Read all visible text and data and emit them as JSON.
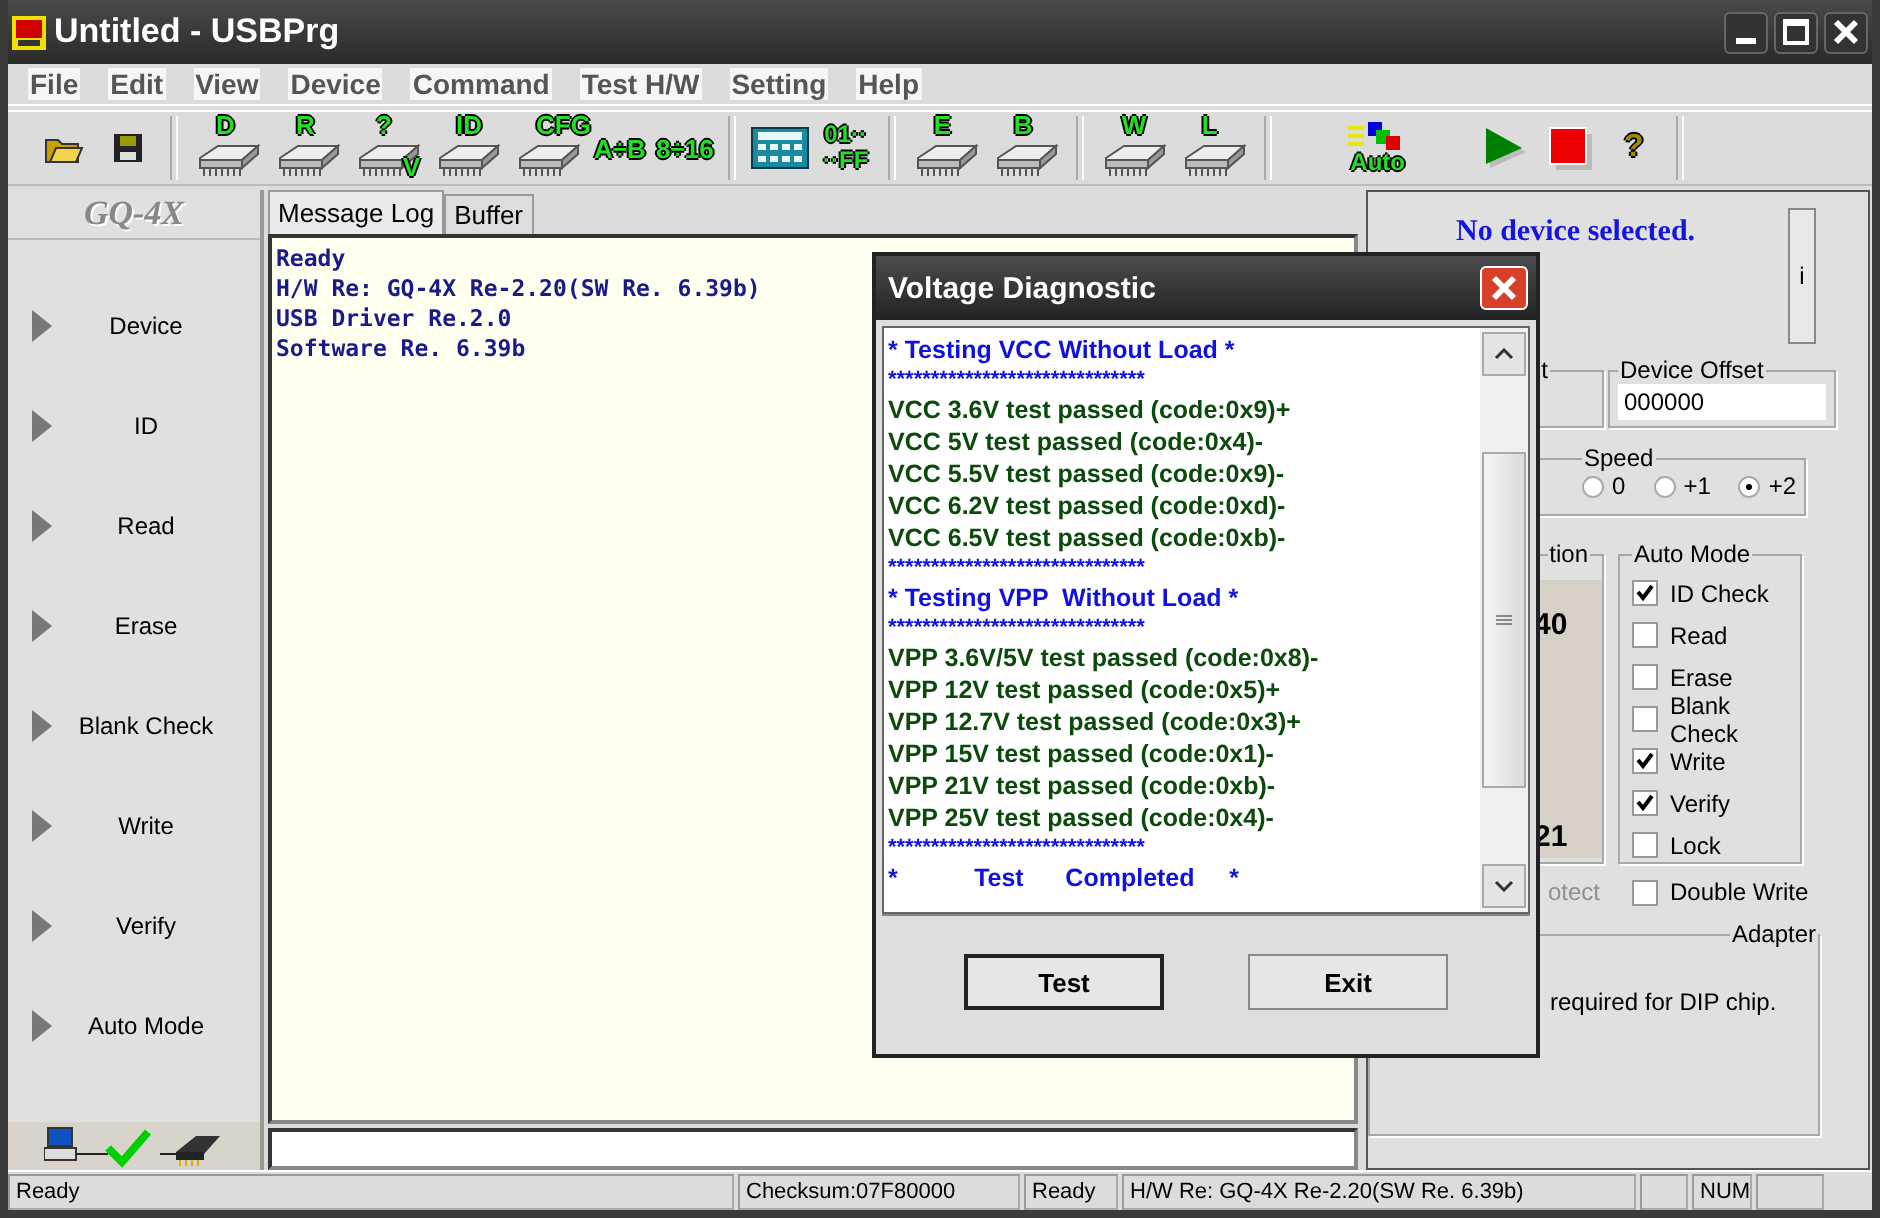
{
  "window": {
    "title": "Untitled - USBPrg"
  },
  "menu": [
    "File",
    "Edit",
    "View",
    "Device",
    "Command",
    "Test H/W",
    "Setting",
    "Help"
  ],
  "toolbar": [
    {
      "kind": "open"
    },
    {
      "kind": "save"
    },
    {
      "kind": "separator"
    },
    {
      "kind": "chip",
      "label": "D"
    },
    {
      "kind": "chip",
      "label": "R"
    },
    {
      "kind": "chip",
      "label": "?",
      "sub": "V"
    },
    {
      "kind": "chip",
      "label": "ID"
    },
    {
      "kind": "chip",
      "label": "CFG"
    },
    {
      "kind": "text",
      "label": "A÷B"
    },
    {
      "kind": "text",
      "label": "8÷16"
    },
    {
      "kind": "separator"
    },
    {
      "kind": "calculator"
    },
    {
      "kind": "hex",
      "label": "01··",
      "sub": "··FF"
    },
    {
      "kind": "separator"
    },
    {
      "kind": "chip",
      "label": "E"
    },
    {
      "kind": "chip",
      "label": "B"
    },
    {
      "kind": "separator"
    },
    {
      "kind": "chip",
      "label": "W"
    },
    {
      "kind": "chip",
      "label": "L"
    },
    {
      "kind": "separator"
    },
    {
      "kind": "auto",
      "label": "Auto"
    },
    {
      "kind": "play"
    },
    {
      "kind": "stop"
    },
    {
      "kind": "help",
      "label": "?"
    },
    {
      "kind": "separator"
    }
  ],
  "sidebar": {
    "logo": "GQ-4X",
    "items": [
      "Device",
      "ID",
      "Read",
      "Erase",
      "Blank Check",
      "Write",
      "Verify",
      "Auto Mode"
    ]
  },
  "tabs": [
    {
      "label": "Message Log",
      "selected": true
    },
    {
      "label": "Buffer",
      "selected": false
    }
  ],
  "message_log": [
    "Ready",
    "H/W Re: GQ-4X Re-2.20(SW Re. 6.39b)",
    "USB Driver Re.2.0",
    "Software Re. 6.39b"
  ],
  "right_panel": {
    "device_status": "No device selected.",
    "info_button": "i",
    "left_group": {
      "label": "t"
    },
    "device_offset": {
      "label": "Device Offset",
      "value": "000000"
    },
    "speed": {
      "label": "Speed",
      "options": [
        {
          "label": "0",
          "selected": false
        },
        {
          "label": "+1",
          "selected": false
        },
        {
          "label": "+2",
          "selected": true
        }
      ]
    },
    "chip_group": {
      "label": "tion",
      "pins": [
        "40",
        "21"
      ]
    },
    "auto_mode": {
      "label": "Auto Mode",
      "options": [
        {
          "label": "ID Check",
          "checked": true
        },
        {
          "label": "Read",
          "checked": false
        },
        {
          "label": "Erase",
          "checked": false
        },
        {
          "label": "Blank Check",
          "checked": false
        },
        {
          "label": "Write",
          "checked": true
        },
        {
          "label": "Verify",
          "checked": true
        },
        {
          "label": "Lock",
          "checked": false
        }
      ]
    },
    "write_protect": {
      "label": "otect",
      "disabled": true
    },
    "double_write": {
      "label": "Double Write",
      "checked": false
    },
    "adapter": {
      "label": "Adapter",
      "note": "required for DIP chip."
    }
  },
  "dialog": {
    "title": "Voltage Diagnostic",
    "lines": [
      {
        "kind": "header",
        "text": "* Testing VCC Without Load *"
      },
      {
        "kind": "stars",
        "text": "******************************"
      },
      {
        "kind": "result",
        "text": "VCC 3.6V test passed (code:0x9)+"
      },
      {
        "kind": "result",
        "text": "VCC 5V test passed (code:0x4)-"
      },
      {
        "kind": "result",
        "text": "VCC 5.5V test passed (code:0x9)-"
      },
      {
        "kind": "result",
        "text": "VCC 6.2V test passed (code:0xd)-"
      },
      {
        "kind": "result",
        "text": "VCC 6.5V test passed (code:0xb)-"
      },
      {
        "kind": "stars",
        "text": "******************************"
      },
      {
        "kind": "header",
        "text": "* Testing VPP  Without Load *"
      },
      {
        "kind": "stars",
        "text": "******************************"
      },
      {
        "kind": "result",
        "text": "VPP 3.6V/5V test passed (code:0x8)-"
      },
      {
        "kind": "result",
        "text": "VPP 12V test passed (code:0x5)+"
      },
      {
        "kind": "result",
        "text": "VPP 12.7V test passed (code:0x3)+"
      },
      {
        "kind": "result",
        "text": "VPP 15V test passed (code:0x1)-"
      },
      {
        "kind": "result",
        "text": "VPP 21V test passed (code:0xb)-"
      },
      {
        "kind": "result",
        "text": "VPP 25V test passed (code:0x4)-"
      },
      {
        "kind": "stars",
        "text": "******************************"
      },
      {
        "kind": "header",
        "text": "*           Test      Completed     *"
      }
    ],
    "buttons": [
      "Test",
      "Exit"
    ]
  },
  "status_bar": [
    {
      "kind": "text",
      "text": "Ready"
    },
    {
      "kind": "text",
      "text": "Checksum:07F80000"
    },
    {
      "kind": "text",
      "text": "Ready"
    },
    {
      "kind": "text",
      "text": "H/W Re: GQ-4X Re-2.20(SW Re. 6.39b)"
    },
    {
      "kind": "blank"
    },
    {
      "kind": "text",
      "text": "NUM"
    },
    {
      "kind": "blank"
    }
  ]
}
